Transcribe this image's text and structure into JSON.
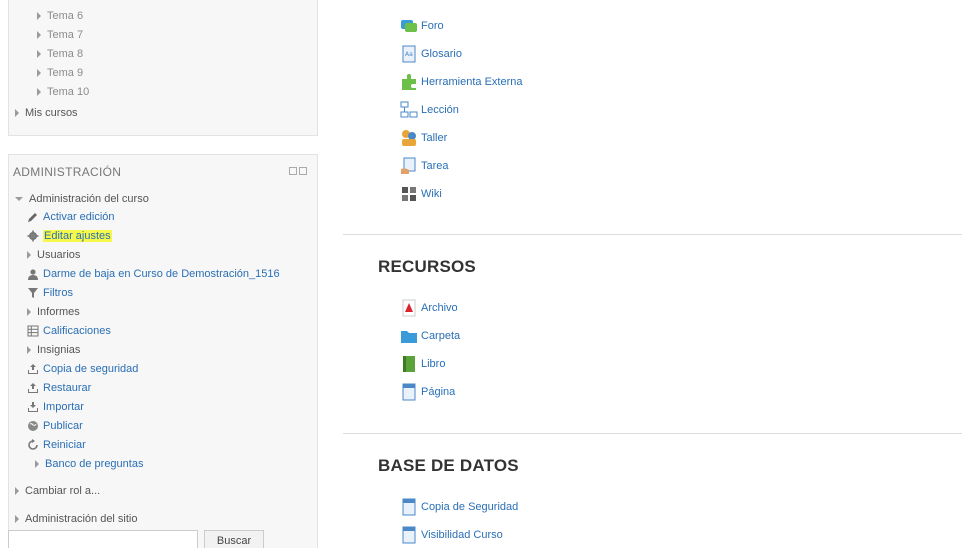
{
  "nav": {
    "topics": [
      "Tema 6",
      "Tema 7",
      "Tema 8",
      "Tema 9",
      "Tema 10"
    ],
    "my_courses": "Mis cursos"
  },
  "admin": {
    "title": "ADMINISTRACIÓN",
    "course_admin": "Administración del curso",
    "items": [
      "Activar edición",
      "Editar ajustes",
      "Usuarios",
      "Darme de baja en Curso de Demostración_1516",
      "Filtros",
      "Informes",
      "Calificaciones",
      "Insignias",
      "Copia de seguridad",
      "Restaurar",
      "Importar",
      "Publicar",
      "Reiniciar",
      "Banco de preguntas"
    ],
    "switch_role": "Cambiar rol a...",
    "site_admin": "Administración del sitio",
    "search_button": "Buscar",
    "search_placeholder": ""
  },
  "activities": [
    "Foro",
    "Glosario",
    "Herramienta Externa",
    "Lección",
    "Taller",
    "Tarea",
    "Wiki"
  ],
  "resources": {
    "heading": "RECURSOS",
    "items": [
      "Archivo",
      "Carpeta",
      "Libro",
      "Página"
    ]
  },
  "database": {
    "heading": "BASE DE DATOS",
    "items": [
      "Copia de Seguridad",
      "Visibilidad Curso"
    ]
  },
  "colors": {
    "link": "#2a6fb5",
    "highlight": "#f6f84a"
  }
}
